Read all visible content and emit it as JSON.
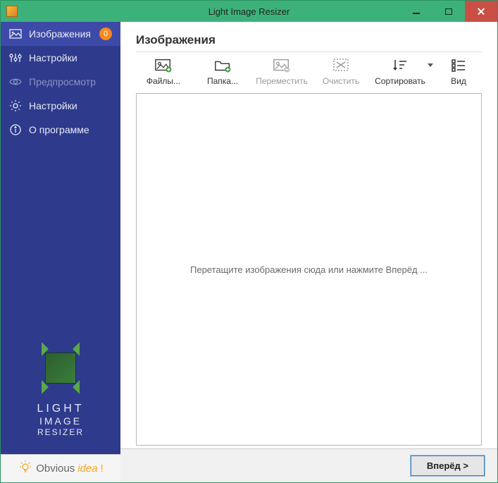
{
  "window": {
    "title": "Light Image Resizer"
  },
  "sidebar": {
    "items": [
      {
        "label": "Изображения",
        "badge": "0"
      },
      {
        "label": "Настройки"
      },
      {
        "label": "Предпросмотр"
      },
      {
        "label": "Настройки"
      },
      {
        "label": "О программе"
      }
    ],
    "logo": {
      "line1": "LIGHT",
      "line2": "IMAGE",
      "line3": "RESIZER"
    },
    "brand": {
      "part1": "Obvious",
      "part2": "idea",
      "excl": "!"
    }
  },
  "page": {
    "title": "Изображения"
  },
  "toolbar": {
    "files": "Файлы...",
    "folder": "Папка...",
    "move": "Переместить",
    "clear": "Очистить",
    "sort": "Сортировать",
    "view": "Вид"
  },
  "dropzone": {
    "hint": "Перетащите изображения сюда или нажмите Вперёд ..."
  },
  "footer": {
    "next": "Вперёд >"
  }
}
